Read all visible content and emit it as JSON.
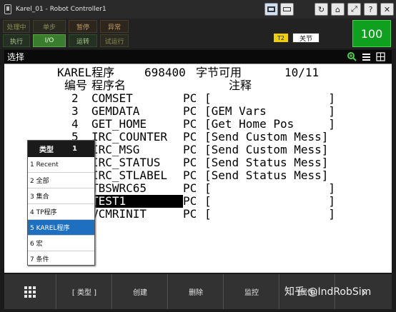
{
  "window": {
    "title": "Karel_01 - Robot Controller1"
  },
  "status": {
    "row1": [
      "处理中",
      "单步",
      "暂停",
      "异常"
    ],
    "row2": [
      "执行",
      "I/O",
      "运转",
      "试运行"
    ],
    "t2": "T2",
    "mode": "关节",
    "override": "100"
  },
  "menu": {
    "title": "选择"
  },
  "header": {
    "title": "KAREL程序",
    "bytes": "698400",
    "bytes_label": "字节可用",
    "page": "10/11"
  },
  "columns": {
    "no": "编号",
    "name": "程序名",
    "comment": "注释"
  },
  "programs": [
    {
      "no": "2",
      "name": "COMSET",
      "type": "PC",
      "comment": "[                 ]"
    },
    {
      "no": "3",
      "name": "GEMDATA",
      "type": "PC",
      "comment": "[GEM Vars         ]"
    },
    {
      "no": "4",
      "name": "GET_HOME",
      "type": "PC",
      "comment": "[Get Home Pos     ]"
    },
    {
      "no": "5",
      "name": "IRC_COUNTER",
      "type": "PC",
      "comment": "[Send Custom Mess]"
    },
    {
      "no": "",
      "name": "IRC_MSG",
      "type": "PC",
      "comment": "[Send Custom Mess]"
    },
    {
      "no": "",
      "name": "IRC_STATUS",
      "type": "PC",
      "comment": "[Send Status Mess]"
    },
    {
      "no": "",
      "name": "IRC_STLABEL",
      "type": "PC",
      "comment": "[Send Status Mess]"
    },
    {
      "no": "",
      "name": "TBSWRC65",
      "type": "PC",
      "comment": "[                 ]"
    },
    {
      "no": "",
      "name": "TEST1",
      "type": "PC",
      "comment": "[                 ]"
    },
    {
      "no": "",
      "name": "VCMRINIT",
      "type": "PC",
      "comment": "[                 ]"
    }
  ],
  "popup": {
    "title": "类型",
    "page": "1",
    "items": [
      "1 Recent",
      "2 全部",
      "3 集合",
      "4 TP程序",
      "5 KAREL程序",
      "6 宏",
      "7 条件"
    ]
  },
  "fkeys": [
    "[ 类型 ]",
    "创建",
    "删除",
    "监控",
    "[属性]"
  ],
  "watermark": "知乎 @IndRobSim"
}
